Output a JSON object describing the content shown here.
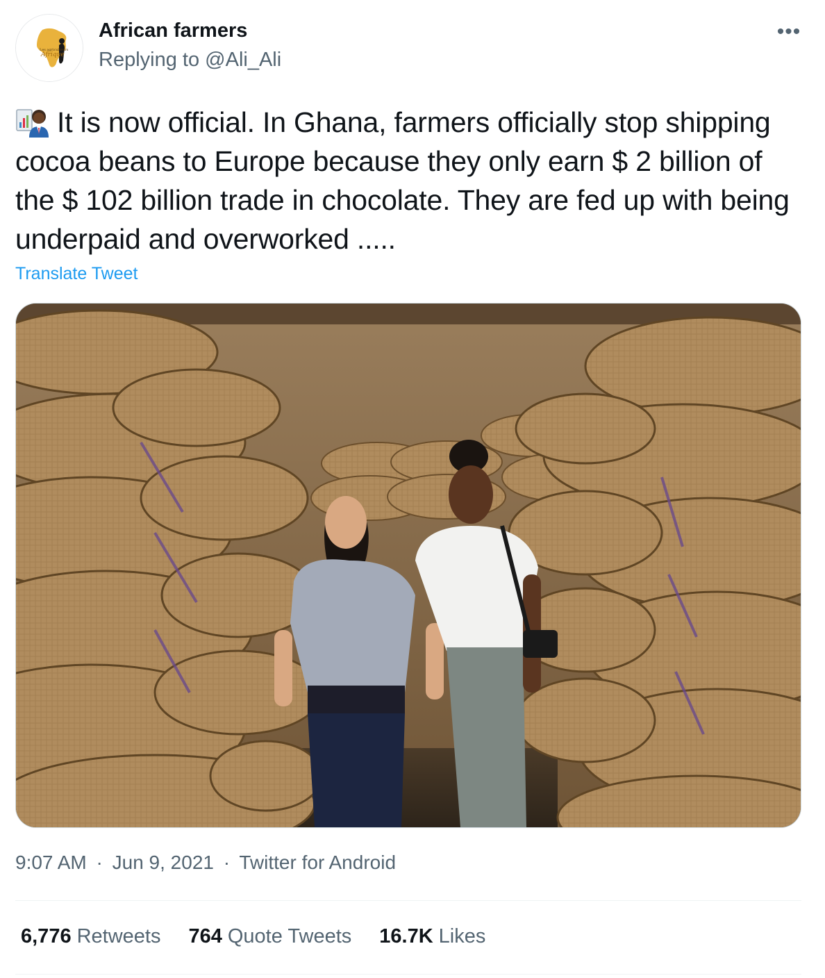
{
  "author": {
    "name": "African farmers",
    "reply_prefix": "Replying to",
    "reply_handle": "@Ali_Ali",
    "avatar_text_line1": "Les agriculteurs",
    "avatar_text_line2": "Afrique"
  },
  "more_icon": "more-horizontal-icon",
  "tweet": {
    "emoji": "man-technologist-emoji",
    "text": "It is now official. In Ghana, farmers officially stop shipping cocoa beans to Europe because they only earn $ 2 billion of the $ 102 billion trade in chocolate. They are fed up with being underpaid and overworked .....",
    "translate_label": "Translate Tweet"
  },
  "meta": {
    "time": "9:07 AM",
    "separator": "·",
    "date": "Jun 9, 2021",
    "source": "Twitter for Android"
  },
  "stats": {
    "retweets_count": "6,776",
    "retweets_label": "Retweets",
    "quotes_count": "764",
    "quotes_label": "Quote Tweets",
    "likes_count": "16.7K",
    "likes_label": "Likes"
  },
  "colors": {
    "accent": "#1d9bf0",
    "secondary_text": "#536471",
    "primary_text": "#0f1419"
  }
}
